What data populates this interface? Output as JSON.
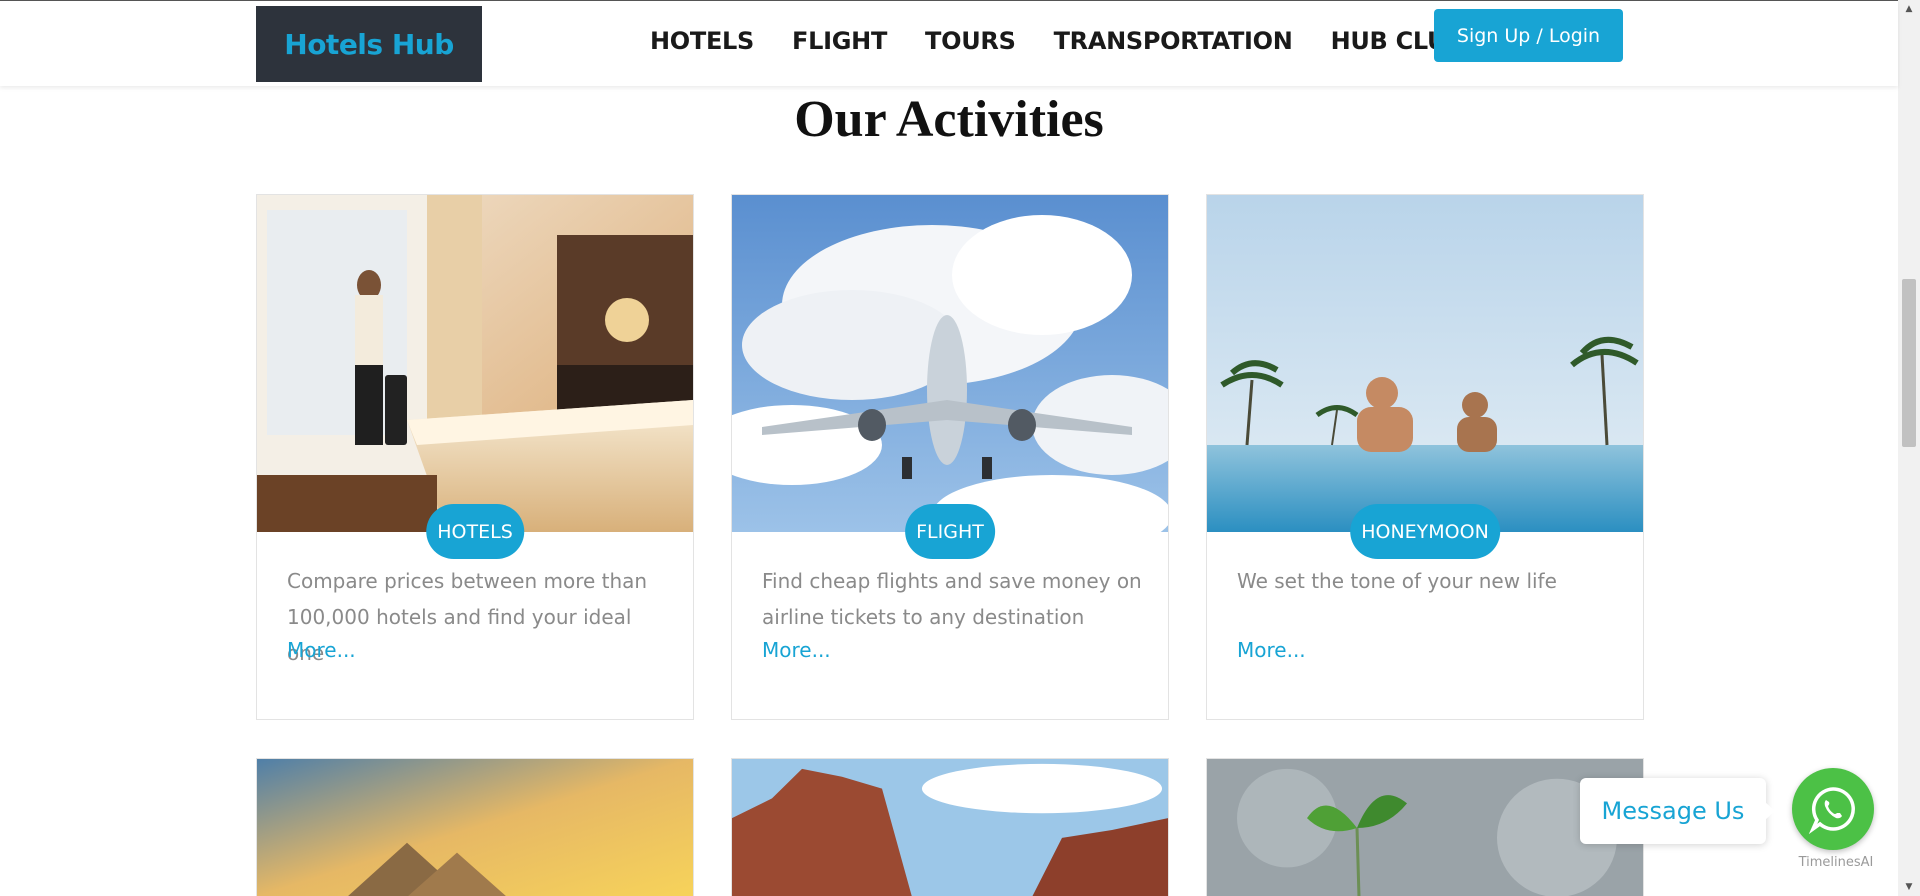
{
  "header": {
    "logo": "Hotels Hub",
    "nav": [
      "HOTELS",
      "FLIGHT",
      "TOURS",
      "TRANSPORTATION",
      "HUB CLUB"
    ],
    "signup_label": "Sign Up / Login"
  },
  "section": {
    "title": "Our Activities"
  },
  "cards": [
    {
      "tag": "HOTELS",
      "description": "Compare prices between more than 100,000 hotels and find your ideal one",
      "more": "More..."
    },
    {
      "tag": "FLIGHT",
      "description": "Find cheap flights and save money on airline tickets to any destination",
      "more": "More..."
    },
    {
      "tag": "HONEYMOON",
      "description": "We set the tone of your new life",
      "more": "More..."
    }
  ],
  "widget": {
    "message_label": "Message Us",
    "brand": "TimelinesAI"
  },
  "colors": {
    "accent": "#18a4d4",
    "logo_bg": "#2d333c",
    "whatsapp": "#4cc146"
  }
}
